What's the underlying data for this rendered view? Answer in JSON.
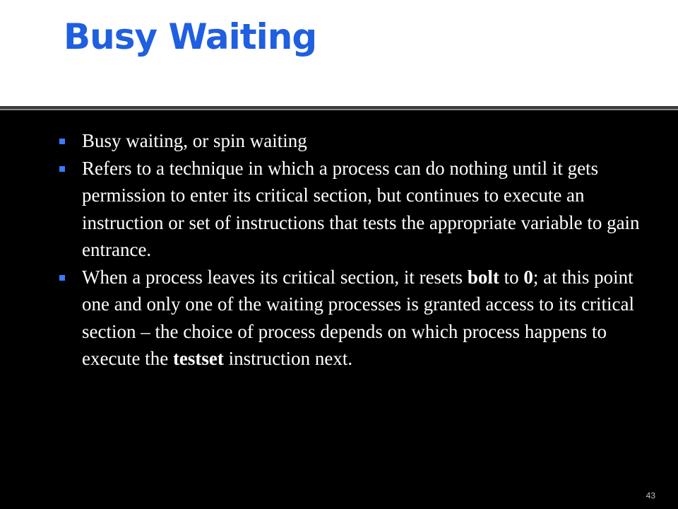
{
  "slide": {
    "title": "Busy Waiting",
    "page_number": "43",
    "colors": {
      "title": "#1f5fe0",
      "bullet": "#3a7bff",
      "background": "#000000",
      "header": "#ffffff"
    },
    "bullet_icon": "square-bullet-icon",
    "bullets": [
      {
        "text": "Busy waiting, or spin waiting"
      },
      {
        "text": "Refers to a technique in which a process can do nothing until it gets permission to enter its critical section, but continues to execute an instruction or set of instructions that tests the appropriate variable to gain entrance."
      },
      {
        "part1": "When a process leaves its critical section, it resets ",
        "bold1": "bolt",
        "part2": " to ",
        "bold2": "0",
        "part3": "; at this point one and only one of the waiting processes is granted access to its critical section – the choice of process depends on which process happens to execute the ",
        "bold3": "testset",
        "part4": " instruction next."
      }
    ]
  }
}
